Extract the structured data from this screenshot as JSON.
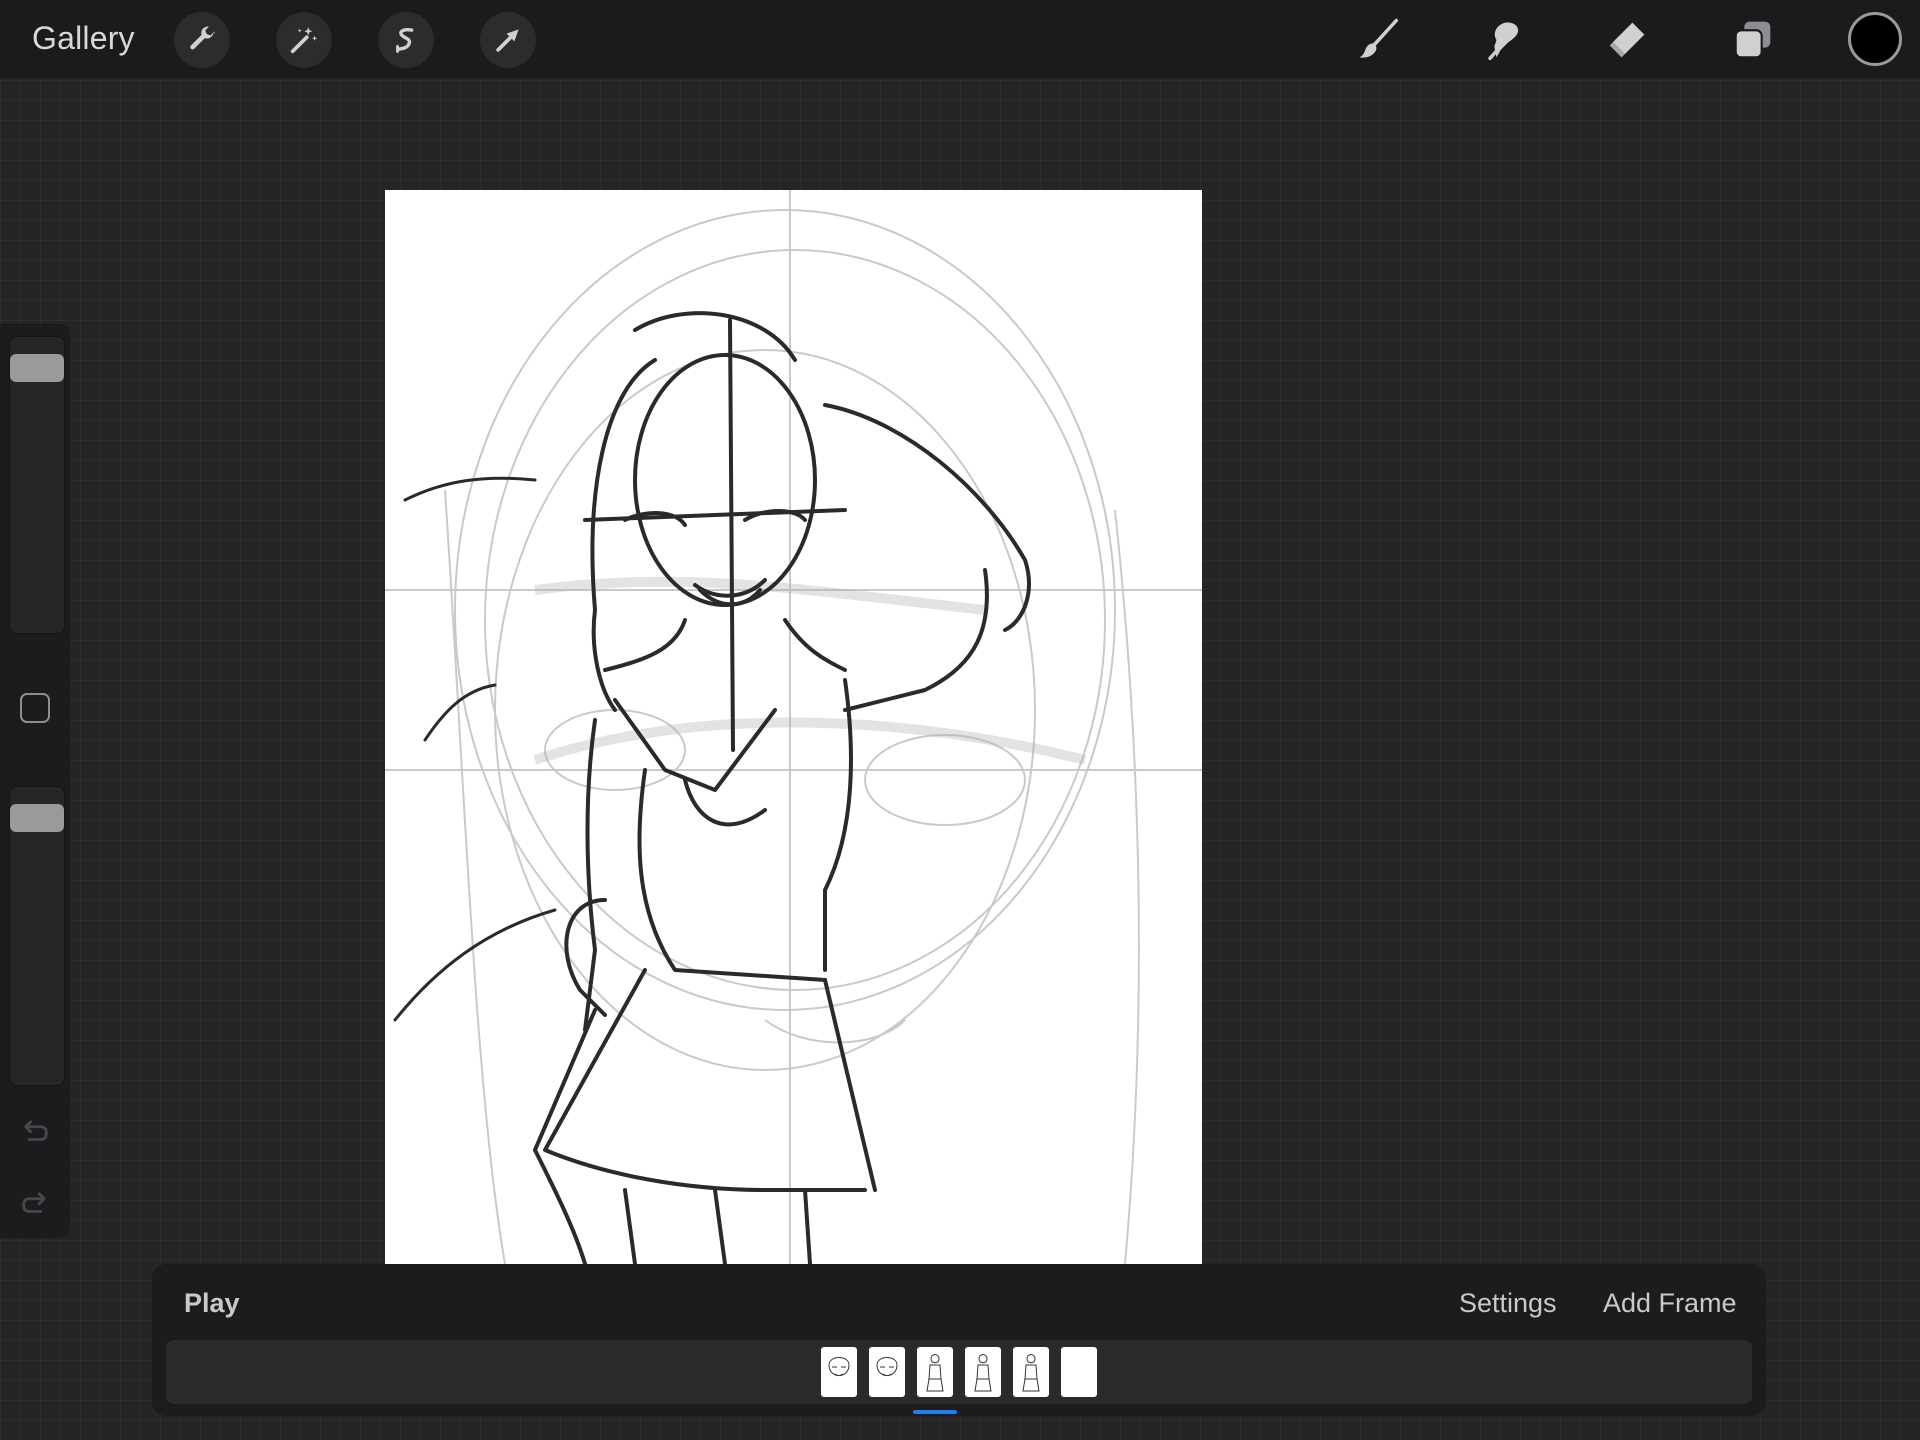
{
  "topbar": {
    "gallery_label": "Gallery",
    "left_tools": [
      "wrench-icon",
      "magic-wand-icon",
      "selection-s-icon",
      "transform-arrow-icon"
    ],
    "right_tools": [
      "brush-icon",
      "smudge-icon",
      "eraser-icon",
      "layers-icon"
    ],
    "current_color": "#000000"
  },
  "sidebar": {
    "size_slider_value": 0.95,
    "opacity_slider_value": 0.95
  },
  "animation": {
    "play_label": "Play",
    "settings_label": "Settings",
    "add_frame_label": "Add Frame",
    "frame_count": 6,
    "active_frame": 3,
    "accent_color": "#1f7cf5"
  }
}
